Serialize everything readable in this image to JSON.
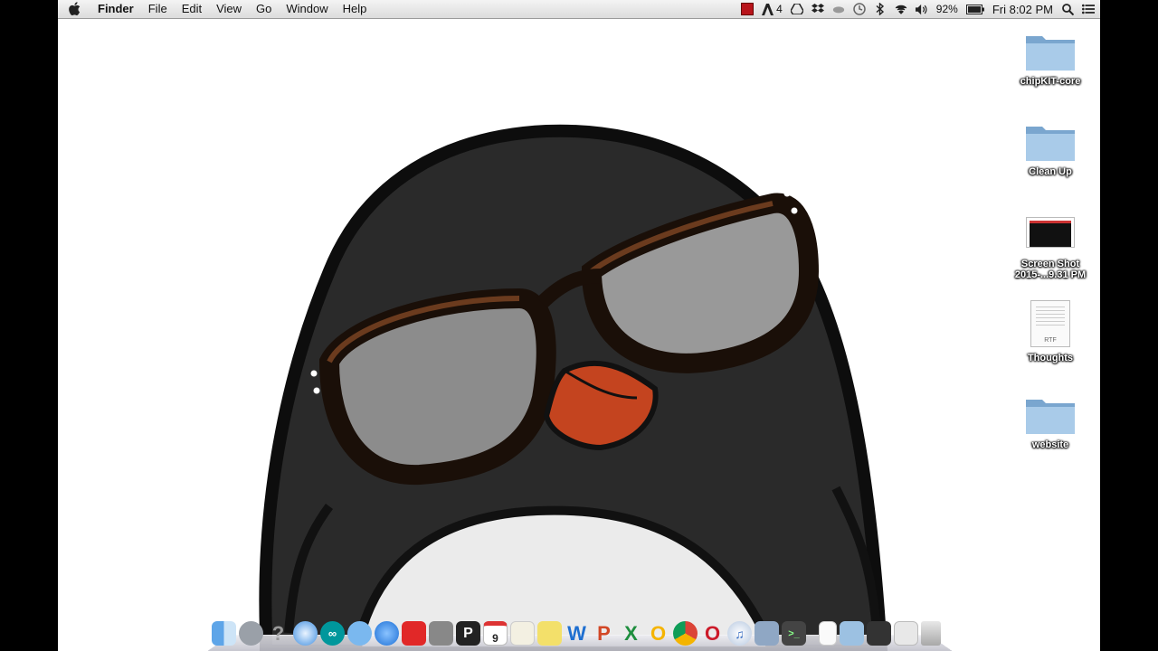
{
  "menubar": {
    "app_name": "Finder",
    "menus": [
      "File",
      "Edit",
      "View",
      "Go",
      "Window",
      "Help"
    ],
    "status": {
      "adobe_count": "4",
      "battery": "92%",
      "clock": "Fri 8:02 PM"
    }
  },
  "desktop": {
    "icons": [
      {
        "label": "chipKIT-core",
        "type": "folder-icon"
      },
      {
        "label": "Clean Up",
        "type": "folder-icon"
      },
      {
        "label": "Screen Shot",
        "label2": "2015-...9.31 PM",
        "type": "screenshot-file-icon"
      },
      {
        "label": "Thoughts",
        "badge": "RTF",
        "type": "rtf-document-icon"
      },
      {
        "label": "website",
        "type": "folder-icon"
      }
    ]
  },
  "dock": {
    "items": [
      "finder-icon",
      "launchpad-icon",
      "help-icon",
      "safari-icon",
      "arduino-icon",
      "messages-icon",
      "app-store-icon",
      "flipboard-icon",
      "preview-icon",
      "pages-icon",
      "calendar-icon",
      "notes-icon",
      "stickies-icon",
      "word-icon",
      "powerpoint-icon",
      "excel-icon",
      "outlook-icon",
      "chrome-icon",
      "opera-icon",
      "itunes-icon",
      "photos-icon",
      "terminal-icon",
      "document-icon",
      "folder-icon",
      "downloads-icon",
      "mail-stack-icon",
      "trash-icon"
    ],
    "calendar_day": "9",
    "colors": {
      "word": "#1f6fd0",
      "powerpoint": "#d24726",
      "excel": "#1e8e3e",
      "outlook": "#f5b400"
    }
  },
  "wallpaper": "cartoon-penguin-with-sunglasses"
}
